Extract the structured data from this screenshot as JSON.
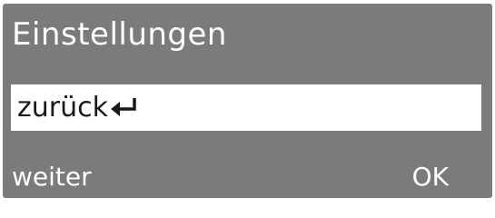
{
  "screen": {
    "title": "Einstellungen",
    "background_color": "#7b7b7b",
    "selected_item": {
      "label": "zurück",
      "icon": "return-arrow-icon"
    },
    "softkeys": {
      "left_label": "weiter",
      "right_label": "OK"
    }
  }
}
